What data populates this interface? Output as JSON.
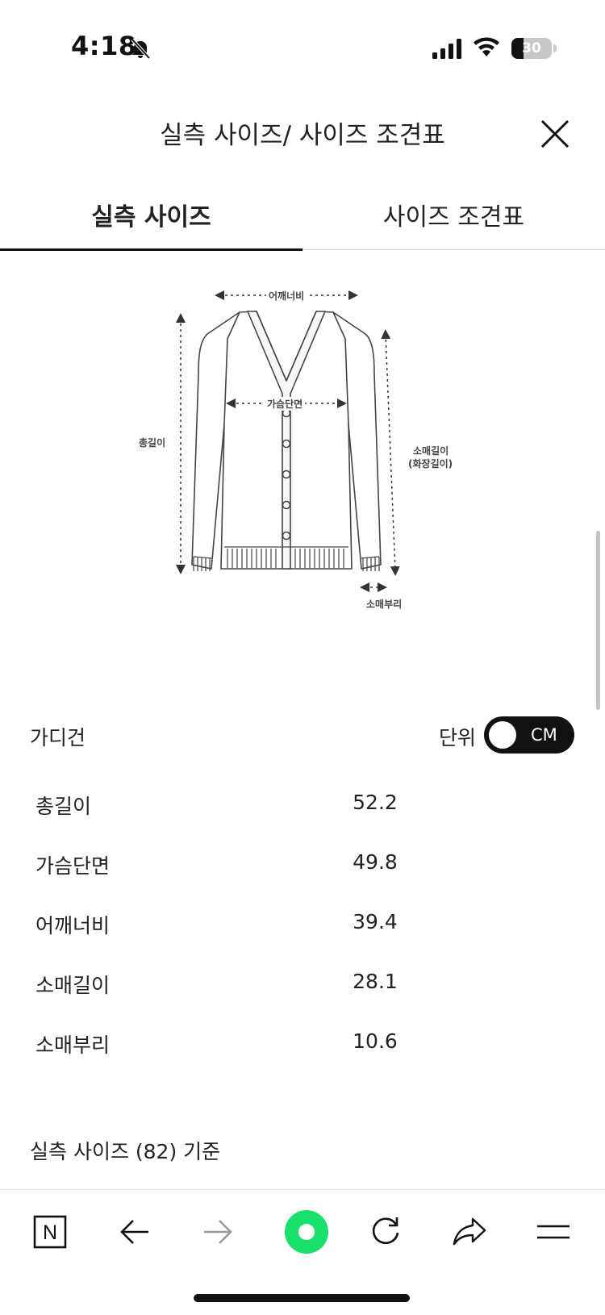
{
  "status_bar": {
    "time": "4:18",
    "battery_level": "30",
    "battery_fraction": 0.3
  },
  "header": {
    "title": "실측 사이즈/ 사이즈 조견표"
  },
  "tabs": [
    {
      "label": "실측 사이즈",
      "active": true
    },
    {
      "label": "사이즈 조견표",
      "active": false
    }
  ],
  "diagram": {
    "labels": {
      "shoulder": "어깨너비",
      "chest": "가슴단면",
      "length": "총길이",
      "sleeve_line1": "소매길이",
      "sleeve_line2": "(화장길이)",
      "cuff": "소매부리"
    }
  },
  "product": {
    "name": "가디건",
    "unit_label": "단위",
    "unit_value": "CM"
  },
  "measurements": [
    {
      "label": "총길이",
      "value": "52.2"
    },
    {
      "label": "가슴단면",
      "value": "49.8"
    },
    {
      "label": "어깨너비",
      "value": "39.4"
    },
    {
      "label": "소매길이",
      "value": "28.1"
    },
    {
      "label": "소매부리",
      "value": "10.6"
    }
  ],
  "basis_note": "실측 사이즈 (82) 기준",
  "toolbar": {
    "buttons": [
      "naver-home-icon",
      "back-icon",
      "forward-icon",
      "green-dot-icon",
      "refresh-icon",
      "share-icon",
      "menu-icon"
    ],
    "accent_color": "#19e06a",
    "home_label": "N"
  }
}
